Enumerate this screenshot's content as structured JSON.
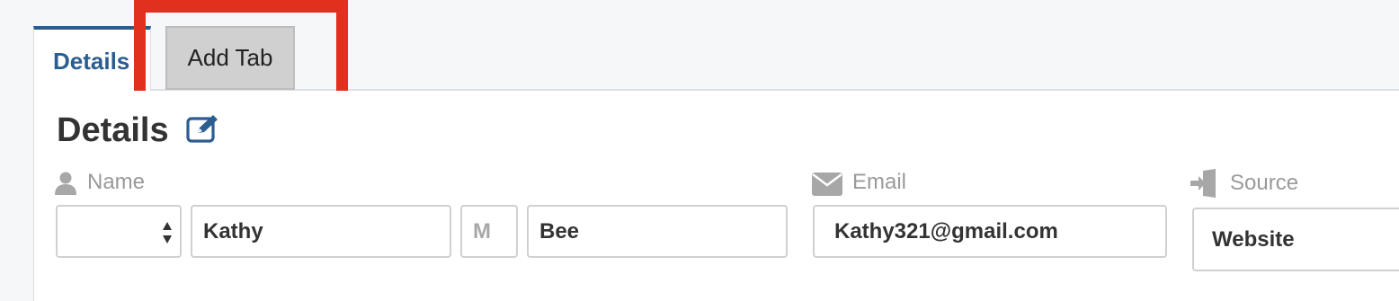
{
  "tabs": {
    "details_label": "Details",
    "add_tab_label": "Add Tab"
  },
  "section": {
    "title": "Details"
  },
  "name_field": {
    "label": "Name",
    "first_name": "Kathy",
    "middle_initial_placeholder": "M",
    "last_name": "Bee"
  },
  "email_field": {
    "label": "Email",
    "value": "Kathy321@gmail.com"
  },
  "source_field": {
    "label": "Source",
    "value": "Website"
  },
  "icons": {
    "edit": "edit-icon",
    "name": "user-icon",
    "email": "envelope-icon",
    "source": "sign-in-icon",
    "prefix_select": "select-arrows-icon"
  },
  "colors": {
    "accent": "#2c5d8f",
    "highlight": "#e2301f",
    "add_tab_bg": "#d0d0d0"
  }
}
